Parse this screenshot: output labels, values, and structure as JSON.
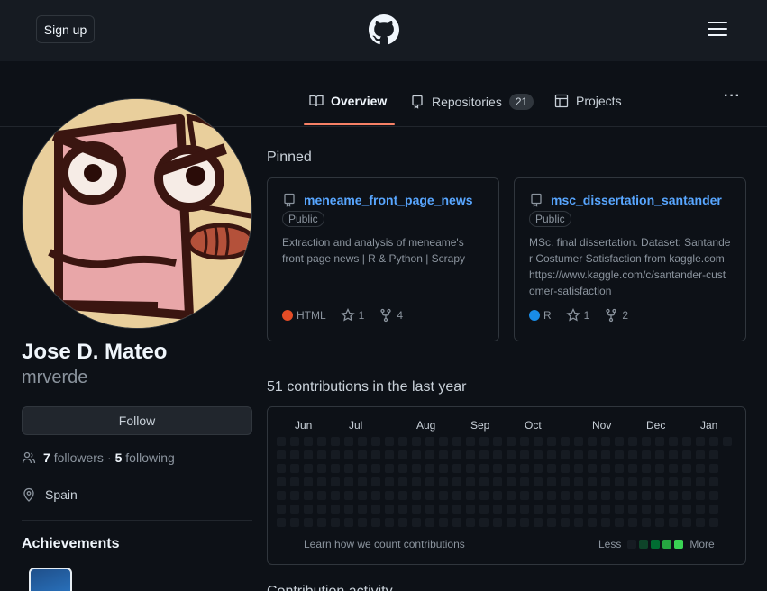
{
  "header": {
    "signup_label": "Sign up",
    "logo_icon": "github-icon",
    "menu_icon": "hamburger-icon"
  },
  "tabs": [
    {
      "label": "Overview",
      "icon": "book-icon",
      "active": true
    },
    {
      "label": "Repositories",
      "icon": "repo-icon",
      "count": "21"
    },
    {
      "label": "Projects",
      "icon": "table-icon"
    }
  ],
  "more_label": "···",
  "profile": {
    "name": "Jose D. Mateo",
    "login": "mrverde",
    "follow_label": "Follow",
    "followers_count": "7",
    "followers_label": "followers",
    "dot": "·",
    "following_count": "5",
    "following_label": "following",
    "location": "Spain",
    "achievements_title": "Achievements"
  },
  "pinned": {
    "title": "Pinned",
    "repos": [
      {
        "name": "meneame_front_page_news",
        "visibility": "Public",
        "description": "Extraction and analysis of meneame's front page news | R & Python | Scrapy",
        "language": "HTML",
        "lang_color": "#e34c26",
        "stars": "1",
        "forks": "4"
      },
      {
        "name": "msc_dissertation_santander",
        "visibility": "Public",
        "description": "MSc. final dissertation. Dataset: Santander Costumer Satisfaction from kaggle.com https://www.kaggle.com/c/santander-customer-satisfaction",
        "language": "R",
        "lang_color": "#198ce7",
        "stars": "1",
        "forks": "2"
      }
    ]
  },
  "contributions": {
    "title": "51 contributions in the last year",
    "months": [
      "Jun",
      "Jul",
      "Aug",
      "Sep",
      "Oct",
      "Nov",
      "Dec",
      "Jan"
    ],
    "learn_label": "Learn how we count contributions",
    "less_label": "Less",
    "more_label": "More",
    "legend_colors": [
      "#161b22",
      "#0e4429",
      "#006d32",
      "#26a641",
      "#39d353"
    ]
  },
  "footer_partial": "Contribution activity"
}
